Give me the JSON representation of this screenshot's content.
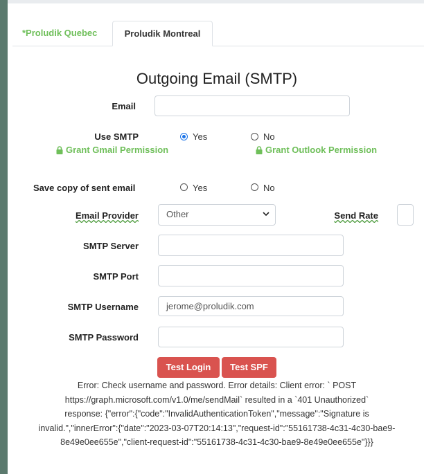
{
  "tabs": [
    {
      "label": "*Proludik Quebec"
    },
    {
      "label": "Proludik Montreal"
    }
  ],
  "section_title": "Outgoing Email (SMTP)",
  "email": {
    "label": "Email",
    "value": ""
  },
  "use_smtp": {
    "label": "Use SMTP",
    "options": [
      {
        "label": "Yes",
        "checked": true
      },
      {
        "label": "No",
        "checked": false
      }
    ]
  },
  "permissions": {
    "gmail": "Grant Gmail Permission",
    "outlook": "Grant Outlook Permission"
  },
  "save_copy": {
    "label": "Save copy of sent email",
    "options": [
      {
        "label": "Yes",
        "checked": false
      },
      {
        "label": "No",
        "checked": false
      }
    ]
  },
  "email_provider": {
    "label": "Email Provider",
    "selected": "Other"
  },
  "send_rate": {
    "label": "Send Rate",
    "value": ""
  },
  "smtp_server": {
    "label": "SMTP Server",
    "value": ""
  },
  "smtp_port": {
    "label": "SMTP Port",
    "value": ""
  },
  "smtp_username": {
    "label": "SMTP Username",
    "value": "jerome@proludik.com"
  },
  "smtp_password": {
    "label": "SMTP Password",
    "value": ""
  },
  "buttons": {
    "test_login": "Test Login",
    "test_spf": "Test SPF"
  },
  "error_lines": [
    "Error: Check username and password. Error details: Client error: ` POST",
    "https://graph.microsoft.com/v1.0/me/sendMail` resulted in a `401 Unauthorized`",
    "response: {\"error\":{\"code\":\"InvalidAuthenticationToken\",\"message\":\"Signature is",
    "invalid.\",\"innerError\":{\"date\":\"2023-03-07T20:14:13\",\"request-id\":\"55161738-4c31-4c30-bae9-",
    "8e49e0ee655e\",\"client-request-id\":\"55161738-4c31-4c30-bae9-8e49e0ee655e\"}}}"
  ],
  "colors": {
    "accent_green": "#6fbf5a",
    "button_red": "#d9534f",
    "sidebar": "#5b7a6e",
    "radio_blue": "#1a73e8"
  }
}
